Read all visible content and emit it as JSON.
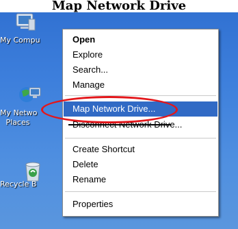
{
  "page": {
    "title": "Map Network Drive"
  },
  "desktop": {
    "icons": [
      {
        "lines": [
          "My Compu"
        ]
      },
      {
        "lines": [
          "My Netwo",
          "Places"
        ]
      },
      {
        "lines": [
          "Recycle B"
        ]
      }
    ]
  },
  "context_menu": {
    "items": [
      {
        "label": "Open"
      },
      {
        "label": "Explore"
      },
      {
        "label": "Search..."
      },
      {
        "label": "Manage"
      },
      {
        "label": "Map Network Drive..."
      },
      {
        "label": "Disconnect Network Drive..."
      },
      {
        "label": "Create Shortcut"
      },
      {
        "label": "Delete"
      },
      {
        "label": "Rename"
      },
      {
        "label": "Properties"
      }
    ]
  },
  "colors": {
    "desktop_blue": "#3d7fdc",
    "menu_highlight": "#316ac5",
    "annotation_red": "#e3161a"
  },
  "annotation": {
    "shape": "ellipse",
    "target": "Map Network Drive..."
  }
}
